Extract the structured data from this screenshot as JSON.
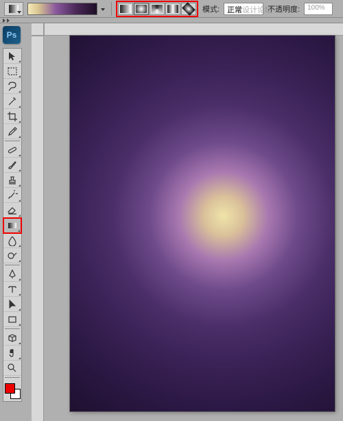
{
  "options_bar": {
    "mode_label": "模式:",
    "mode_value": "正常",
    "watermark": "思缘设计论坛",
    "opacity_label": "不透明度:",
    "opacity_value": "100%"
  },
  "app_logo": "Ps",
  "tools": [
    {
      "name": "move-tool",
      "icon": "move"
    },
    {
      "name": "marquee-tool",
      "icon": "marquee"
    },
    {
      "name": "lasso-tool",
      "icon": "lasso"
    },
    {
      "name": "wand-tool",
      "icon": "wand"
    },
    {
      "name": "crop-tool",
      "icon": "crop"
    },
    {
      "name": "eyedropper-tool",
      "icon": "eyedropper"
    },
    {
      "name": "healing-tool",
      "icon": "healing"
    },
    {
      "name": "brush-tool",
      "icon": "brush"
    },
    {
      "name": "stamp-tool",
      "icon": "stamp"
    },
    {
      "name": "history-brush-tool",
      "icon": "hbrush"
    },
    {
      "name": "eraser-tool",
      "icon": "eraser"
    },
    {
      "name": "gradient-tool",
      "icon": "gradient",
      "selected": true,
      "highlighted": true
    },
    {
      "name": "blur-tool",
      "icon": "blur"
    },
    {
      "name": "dodge-tool",
      "icon": "dodge"
    },
    {
      "name": "pen-tool",
      "icon": "pen"
    },
    {
      "name": "type-tool",
      "icon": "type"
    },
    {
      "name": "path-tool",
      "icon": "path"
    },
    {
      "name": "shape-tool",
      "icon": "shape"
    },
    {
      "name": "3d-tool",
      "icon": "3d"
    },
    {
      "name": "hand-tool",
      "icon": "hand"
    },
    {
      "name": "zoom-tool",
      "icon": "zoom"
    }
  ],
  "gradient_types": [
    {
      "name": "linear",
      "active": false
    },
    {
      "name": "radial",
      "active": true
    },
    {
      "name": "angle",
      "active": false
    },
    {
      "name": "reflected",
      "active": false
    },
    {
      "name": "diamond",
      "active": false
    }
  ],
  "colors": {
    "foreground": "#e00000",
    "background": "#ffffff"
  }
}
